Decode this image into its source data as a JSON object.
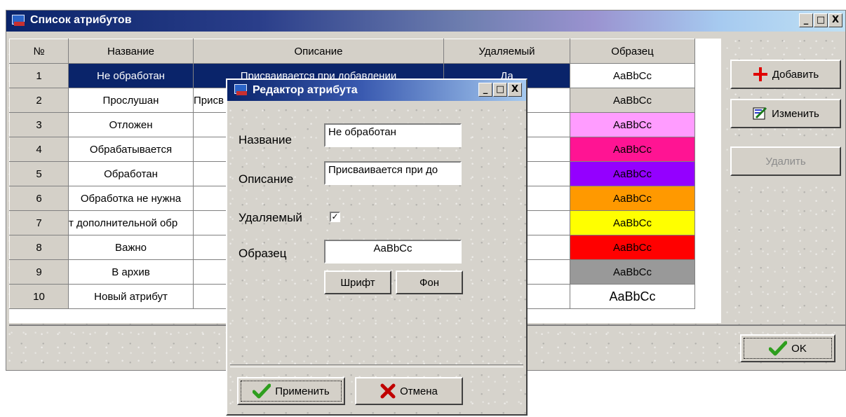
{
  "main_window": {
    "title": "Список атрибутов",
    "controls": {
      "minimize": "_",
      "maximize": "□",
      "close": "X"
    }
  },
  "table": {
    "headers": [
      "№",
      "Название",
      "Описание",
      "Удаляемый",
      "Образец"
    ],
    "rows": [
      {
        "num": "1",
        "name": "Не обработан",
        "desc": "Присваивается при добавлении",
        "deletable": "Да",
        "sample": "AaBbCc",
        "bg": "#ffffff",
        "fg": "#000000",
        "selected": true
      },
      {
        "num": "2",
        "name": "Прослушан",
        "desc": "Присв",
        "deletable": "",
        "sample": "AaBbCc",
        "bg": "#d4d0c8",
        "fg": "#000000"
      },
      {
        "num": "3",
        "name": "Отложен",
        "desc": "",
        "deletable": "",
        "sample": "AaBbCc",
        "bg": "#ff9cff",
        "fg": "#000000"
      },
      {
        "num": "4",
        "name": "Обрабатывается",
        "desc": "",
        "deletable": "",
        "sample": "AaBbCc",
        "bg": "#ff1493",
        "fg": "#000000"
      },
      {
        "num": "5",
        "name": "Обработан",
        "desc": "",
        "deletable": "",
        "sample": "AaBbCc",
        "bg": "#9400ff",
        "fg": "#000000"
      },
      {
        "num": "6",
        "name": "Обработка не нужна",
        "desc": "",
        "deletable": "",
        "sample": "AaBbCc",
        "bg": "#ff9900",
        "fg": "#000000"
      },
      {
        "num": "7",
        "name": "т дополнительной обр",
        "desc": "",
        "deletable": "",
        "sample": "AaBbCc",
        "bg": "#ffff00",
        "fg": "#000000"
      },
      {
        "num": "8",
        "name": "Важно",
        "desc": "",
        "deletable": "",
        "sample": "AaBbCc",
        "bg": "#ff0000",
        "fg": "#000000"
      },
      {
        "num": "9",
        "name": "В архив",
        "desc": "",
        "deletable": "",
        "sample": "AaBbCc",
        "bg": "#999999",
        "fg": "#000000"
      },
      {
        "num": "10",
        "name": "Новый атрибут",
        "desc": "",
        "deletable": "",
        "sample": "AaBbCc",
        "bg": "#ffffff",
        "fg": "#000000"
      }
    ]
  },
  "side_buttons": {
    "add": "Добавить",
    "edit": "Изменить",
    "delete": "Удалить"
  },
  "ok_button": "OK",
  "dialog": {
    "title": "Редактор атрибута",
    "labels": {
      "name": "Название",
      "description": "Описание",
      "deletable": "Удаляемый",
      "sample": "Образец"
    },
    "name_value": "Не обработан",
    "description_value": "Присваивается при до",
    "deletable_checked": "✓",
    "sample_value": "AaBbCc",
    "font_button": "Шрифт",
    "background_button": "Фон",
    "apply_button": "Применить",
    "cancel_button": "Отмена"
  },
  "colors": {
    "title_active": "#0a246a",
    "face": "#d4d0c8",
    "add_icon": "#e00000",
    "ok_check": "#2e9e1e",
    "cancel_x": "#c00000"
  }
}
